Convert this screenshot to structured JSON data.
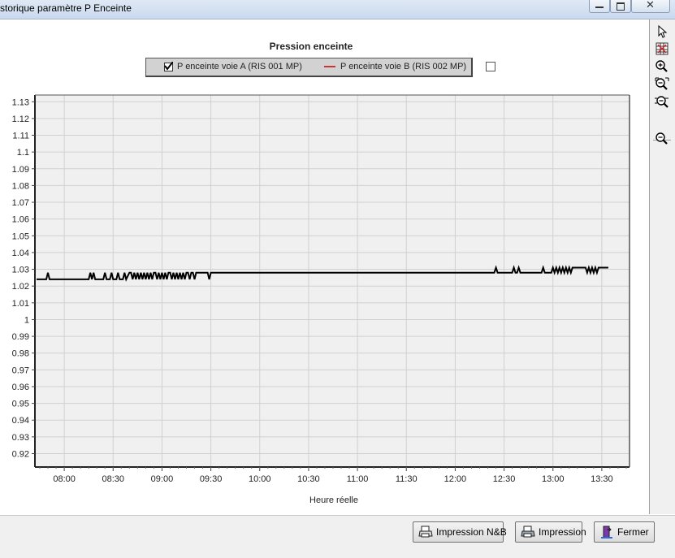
{
  "window": {
    "title": "storique paramètre P Enceinte"
  },
  "chart_title": "Pression enceinte",
  "legend": {
    "items": [
      {
        "label": "P enceinte voie A (RIS 001 MP)",
        "checked": true,
        "color": "#000000"
      },
      {
        "label": "P enceinte voie B (RIS 002 MP)",
        "color": "#cc3333"
      }
    ]
  },
  "buttons": {
    "print_bw": "Impression N&B",
    "print": "Impression",
    "close": "Fermer"
  },
  "toolbar": {
    "icons": [
      "pointer-icon",
      "table-icon",
      "zoom-in-icon",
      "zoom-area-icon",
      "zoom-reset-icon",
      "zoom-out-icon"
    ]
  },
  "chart_data": {
    "type": "line",
    "title": "Pression enceinte",
    "xlabel": "Heure réelle",
    "ylabel": "",
    "xticks": [
      "08:00",
      "08:30",
      "09:00",
      "09:30",
      "10:00",
      "10:30",
      "11:00",
      "11:30",
      "12:00",
      "12:30",
      "13:00",
      "13:30"
    ],
    "yticks": [
      0.92,
      0.93,
      0.94,
      0.95,
      0.96,
      0.97,
      0.98,
      0.99,
      1,
      1.01,
      1.02,
      1.03,
      1.04,
      1.05,
      1.06,
      1.07,
      1.08,
      1.09,
      1.1,
      1.11,
      1.12,
      1.13
    ],
    "xlim": [
      "07:42",
      "13:47"
    ],
    "ylim": [
      0.912,
      1.134
    ],
    "grid": true,
    "series": [
      {
        "name": "P enceinte voie A (RIS 001 MP)",
        "color": "#000000",
        "x": [
          "07:43",
          "07:49",
          "07:50",
          "07:51",
          "08:15",
          "08:16",
          "08:17",
          "08:18",
          "08:19",
          "08:24",
          "08:25",
          "08:26",
          "08:28",
          "08:29",
          "08:30",
          "08:32",
          "08:33",
          "08:34",
          "08:36",
          "08:37",
          "08:38",
          "08:40",
          "08:41",
          "08:42",
          "08:43",
          "08:44",
          "08:45",
          "08:46",
          "08:47",
          "08:48",
          "08:49",
          "08:50",
          "08:51",
          "08:52",
          "08:53",
          "08:54",
          "08:55",
          "08:56",
          "08:57",
          "08:58",
          "08:59",
          "09:00",
          "09:01",
          "09:02",
          "09:03",
          "09:04",
          "09:05",
          "09:06",
          "09:07",
          "09:08",
          "09:09",
          "09:10",
          "09:11",
          "09:12",
          "09:13",
          "09:14",
          "09:15",
          "09:16",
          "09:17",
          "09:18",
          "09:19",
          "09:20",
          "09:21",
          "09:28",
          "09:29",
          "09:30",
          "12:24",
          "12:25",
          "12:26",
          "12:35",
          "12:36",
          "12:37",
          "12:38",
          "12:39",
          "12:40",
          "12:53",
          "12:54",
          "12:55",
          "12:59",
          "13:00",
          "13:01",
          "13:02",
          "13:03",
          "13:04",
          "13:05",
          "13:06",
          "13:07",
          "13:08",
          "13:09",
          "13:10",
          "13:11",
          "13:12",
          "13:13",
          "13:14",
          "13:16",
          "13:20",
          "13:21",
          "13:22",
          "13:23",
          "13:24",
          "13:25",
          "13:26",
          "13:27",
          "13:28",
          "13:30",
          "13:34"
        ],
        "y": [
          1.024,
          1.024,
          1.028,
          1.024,
          1.024,
          1.028,
          1.024,
          1.028,
          1.024,
          1.024,
          1.028,
          1.024,
          1.024,
          1.028,
          1.024,
          1.024,
          1.028,
          1.024,
          1.024,
          1.028,
          1.024,
          1.028,
          1.028,
          1.024,
          1.028,
          1.024,
          1.028,
          1.024,
          1.028,
          1.024,
          1.028,
          1.024,
          1.028,
          1.024,
          1.028,
          1.024,
          1.028,
          1.028,
          1.024,
          1.028,
          1.024,
          1.028,
          1.024,
          1.028,
          1.024,
          1.028,
          1.028,
          1.024,
          1.028,
          1.024,
          1.028,
          1.024,
          1.028,
          1.024,
          1.028,
          1.024,
          1.028,
          1.028,
          1.024,
          1.028,
          1.028,
          1.024,
          1.028,
          1.028,
          1.024,
          1.028,
          1.028,
          1.031,
          1.028,
          1.028,
          1.031,
          1.028,
          1.028,
          1.031,
          1.028,
          1.028,
          1.031,
          1.028,
          1.028,
          1.031,
          1.028,
          1.031,
          1.028,
          1.031,
          1.028,
          1.031,
          1.028,
          1.031,
          1.028,
          1.031,
          1.028,
          1.031,
          1.031,
          1.031,
          1.031,
          1.031,
          1.028,
          1.031,
          1.028,
          1.031,
          1.028,
          1.031,
          1.028,
          1.031,
          1.031,
          1.031
        ]
      }
    ]
  }
}
